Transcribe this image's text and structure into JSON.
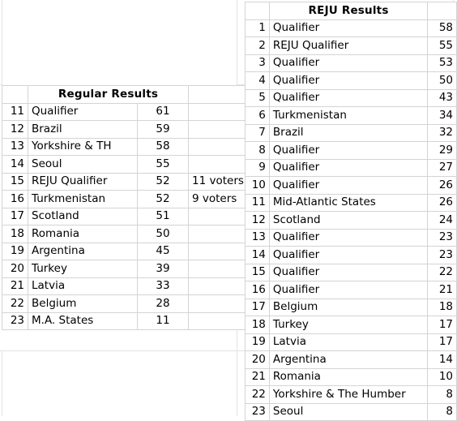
{
  "left_table": {
    "header": "Regular Results",
    "columns": [
      "rank",
      "name",
      "score",
      "note"
    ],
    "rows": [
      {
        "rank": "11",
        "name": "Qualifier",
        "score": "61",
        "note": "",
        "highlight": false
      },
      {
        "rank": "12",
        "name": "Brazil",
        "score": "59",
        "note": "",
        "highlight": false
      },
      {
        "rank": "13",
        "name": "Yorkshire & TH",
        "score": "58",
        "note": "",
        "highlight": false
      },
      {
        "rank": "14",
        "name": "Seoul",
        "score": "55",
        "note": "",
        "highlight": false
      },
      {
        "rank": "15",
        "name": "REJU Qualifier",
        "score": "52",
        "note": "11 voters",
        "highlight": true
      },
      {
        "rank": "16",
        "name": "Turkmenistan",
        "score": "52",
        "note": "9 voters",
        "highlight": false
      },
      {
        "rank": "17",
        "name": "Scotland",
        "score": "51",
        "note": "",
        "highlight": false
      },
      {
        "rank": "18",
        "name": "Romania",
        "score": "50",
        "note": "",
        "highlight": false
      },
      {
        "rank": "19",
        "name": "Argentina",
        "score": "45",
        "note": "",
        "highlight": false
      },
      {
        "rank": "20",
        "name": "Turkey",
        "score": "39",
        "note": "",
        "highlight": false
      },
      {
        "rank": "21",
        "name": "Latvia",
        "score": "33",
        "note": "",
        "highlight": false
      },
      {
        "rank": "22",
        "name": "Belgium",
        "score": "28",
        "note": "",
        "highlight": false
      },
      {
        "rank": "23",
        "name": "M.A. States",
        "score": "11",
        "note": "",
        "highlight": false
      }
    ]
  },
  "right_table": {
    "header": "REJU Results",
    "columns": [
      "rank",
      "name",
      "score"
    ],
    "rows": [
      {
        "rank": "1",
        "name": "Qualifier",
        "score": "58",
        "highlight": false
      },
      {
        "rank": "2",
        "name": "REJU Qualifier",
        "score": "55",
        "highlight": true
      },
      {
        "rank": "3",
        "name": "Qualifier",
        "score": "53",
        "highlight": false
      },
      {
        "rank": "4",
        "name": "Qualifier",
        "score": "50",
        "highlight": false
      },
      {
        "rank": "5",
        "name": "Qualifier",
        "score": "43",
        "highlight": false
      },
      {
        "rank": "6",
        "name": "Turkmenistan",
        "score": "34",
        "highlight": false
      },
      {
        "rank": "7",
        "name": "Brazil",
        "score": "32",
        "highlight": false
      },
      {
        "rank": "8",
        "name": "Qualifier",
        "score": "29",
        "highlight": false
      },
      {
        "rank": "9",
        "name": "Qualifier",
        "score": "27",
        "highlight": false
      },
      {
        "rank": "10",
        "name": "Qualifier",
        "score": "26",
        "highlight": false
      },
      {
        "rank": "11",
        "name": "Mid-Atlantic States",
        "score": "26",
        "highlight": false
      },
      {
        "rank": "12",
        "name": "Scotland",
        "score": "24",
        "highlight": false
      },
      {
        "rank": "13",
        "name": "Qualifier",
        "score": "23",
        "highlight": false
      },
      {
        "rank": "14",
        "name": "Qualifier",
        "score": "23",
        "highlight": false
      },
      {
        "rank": "15",
        "name": "Qualifier",
        "score": "22",
        "highlight": false
      },
      {
        "rank": "16",
        "name": "Qualifier",
        "score": "21",
        "highlight": false
      },
      {
        "rank": "17",
        "name": "Belgium",
        "score": "18",
        "highlight": false
      },
      {
        "rank": "18",
        "name": "Turkey",
        "score": "17",
        "highlight": false
      },
      {
        "rank": "19",
        "name": "Latvia",
        "score": "17",
        "highlight": false
      },
      {
        "rank": "20",
        "name": "Argentina",
        "score": "14",
        "highlight": false
      },
      {
        "rank": "21",
        "name": "Romania",
        "score": "10",
        "highlight": false
      },
      {
        "rank": "22",
        "name": "Yorkshire & The Humber",
        "score": "8",
        "highlight": false
      },
      {
        "rank": "23",
        "name": "Seoul",
        "score": "8",
        "highlight": false
      }
    ]
  },
  "colors": {
    "header_fill": "#a6a6a6",
    "header_text": "#ffffff",
    "header_border": "#3f3f3f",
    "highlight_fill": "#ffffcc",
    "gridline": "#d4d4d4",
    "cell_text": "#000000"
  }
}
